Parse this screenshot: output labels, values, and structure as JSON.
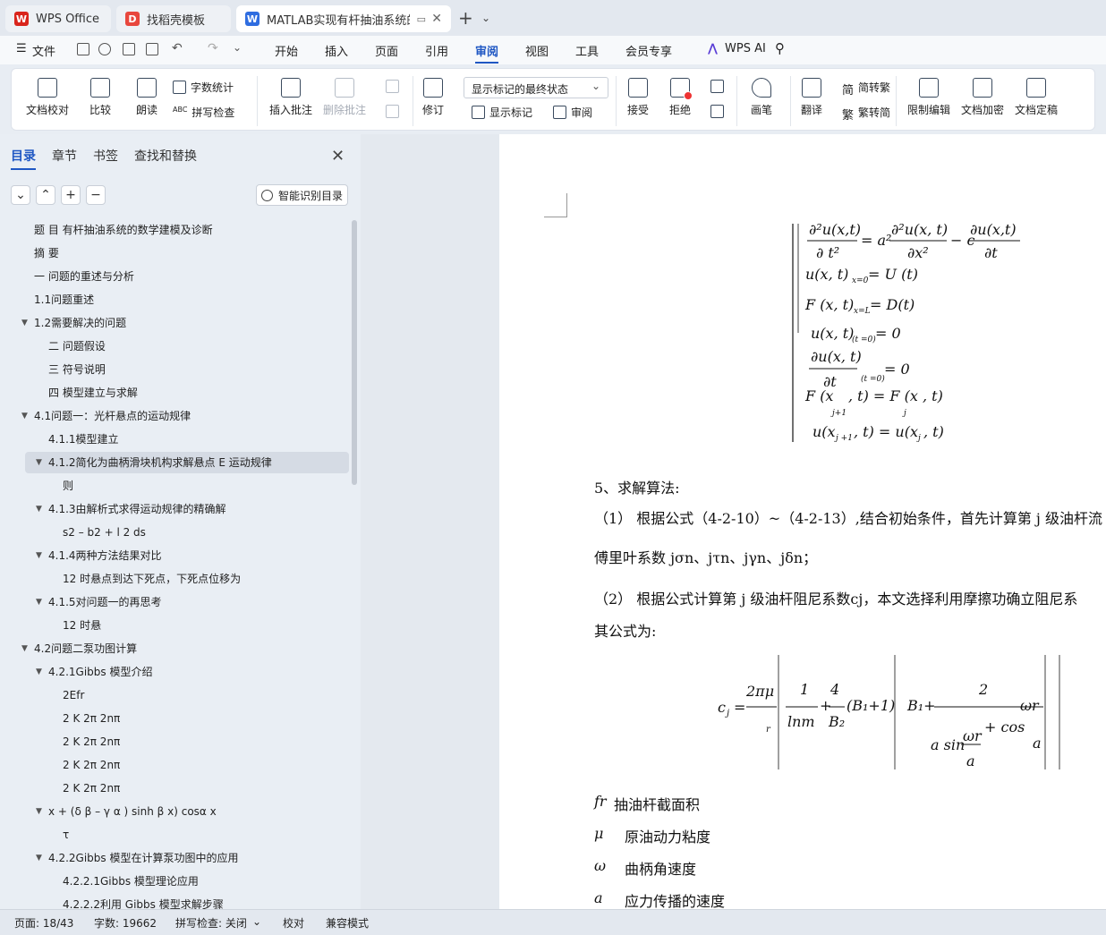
{
  "tabs": [
    {
      "label": "WPS Office",
      "logo": "W"
    },
    {
      "label": "找稻壳模板",
      "logo": "D"
    },
    {
      "label": "MATLAB实现有杆抽油系统的",
      "logo": "W"
    }
  ],
  "menu": {
    "file": "文件",
    "items": [
      "开始",
      "插入",
      "页面",
      "引用",
      "审阅",
      "视图",
      "工具",
      "会员专享"
    ],
    "active": "审阅",
    "wps_ai": "WPS AI"
  },
  "ribbon": {
    "doc_check": "文档校对",
    "compare": "比较",
    "read_aloud": "朗读",
    "word_count": "字数统计",
    "spell_check": "拼写检查",
    "insert_comment": "插入批注",
    "delete_comment": "删除批注",
    "revise": "修订",
    "markup_select": "显示标记的最终状态",
    "show_markup": "显示标记",
    "review": "审阅",
    "accept": "接受",
    "reject": "拒绝",
    "draw": "画笔",
    "translate": "翻译",
    "to_traditional": "简转繁",
    "to_simplified": "繁转简",
    "restrict_edit": "限制编辑",
    "encrypt": "文档加密",
    "finalize": "文档定稿"
  },
  "sidebar": {
    "tabs": [
      "目录",
      "章节",
      "书签",
      "查找和替换"
    ],
    "active_tab": "目录",
    "smart_btn": "智能识别目录",
    "toc": [
      {
        "text": "题 目  有杆抽油系统的数学建模及诊断",
        "level": 0,
        "arrow": false
      },
      {
        "text": "摘  要",
        "level": 0,
        "arrow": false
      },
      {
        "text": "一 问题的重述与分析",
        "level": 0,
        "arrow": false
      },
      {
        "text": "1.1问题重述",
        "level": 0,
        "arrow": false
      },
      {
        "text": "1.2需要解决的问题",
        "level": 0,
        "arrow": true
      },
      {
        "text": "二 问题假设",
        "level": 1,
        "arrow": false
      },
      {
        "text": "三 符号说明",
        "level": 1,
        "arrow": false
      },
      {
        "text": "四 模型建立与求解",
        "level": 1,
        "arrow": false
      },
      {
        "text": "4.1问题一：光杆悬点的运动规律",
        "level": 0,
        "arrow": true
      },
      {
        "text": "4.1.1模型建立",
        "level": 1,
        "arrow": false
      },
      {
        "text": "4.1.2简化为曲柄滑块机构求解悬点 E 运动规律",
        "level": 1,
        "arrow": true,
        "selected": true
      },
      {
        "text": "则",
        "level": 2,
        "arrow": false
      },
      {
        "text": "4.1.3由解析式求得运动规律的精确解",
        "level": 1,
        "arrow": true
      },
      {
        "text": "s2 – b2 + l 2 ds",
        "level": 2,
        "arrow": false
      },
      {
        "text": "4.1.4两种方法结果对比",
        "level": 1,
        "arrow": true
      },
      {
        "text": "12 时悬点到达下死点，下死点位移为",
        "level": 2,
        "arrow": false
      },
      {
        "text": "4.1.5对问题一的再思考",
        "level": 1,
        "arrow": true
      },
      {
        "text": "12 时悬",
        "level": 2,
        "arrow": false
      },
      {
        "text": "4.2问题二泵功图计算",
        "level": 0,
        "arrow": true
      },
      {
        "text": "4.2.1Gibbs 模型介绍",
        "level": 1,
        "arrow": true
      },
      {
        "text": "2Efr",
        "level": 2,
        "arrow": false
      },
      {
        "text": "2  K  2π  2nπ",
        "level": 2,
        "arrow": false
      },
      {
        "text": "2  K  2π  2nπ",
        "level": 2,
        "arrow": false
      },
      {
        "text": "2  K  2π  2nπ",
        "level": 2,
        "arrow": false
      },
      {
        "text": "2  K  2π  2nπ",
        "level": 2,
        "arrow": false
      },
      {
        "text": "x + (δ β – γ α ) sinh β x) cosα x",
        "level": 1,
        "arrow": true
      },
      {
        "text": "τ",
        "level": 2,
        "arrow": false
      },
      {
        "text": "4.2.2Gibbs 模型在计算泵功图中的应用",
        "level": 1,
        "arrow": true
      },
      {
        "text": "4.2.2.1Gibbs 模型理论应用",
        "level": 2,
        "arrow": false
      },
      {
        "text": "4.2.2.2利用 Gibbs 模型求解步骤",
        "level": 2,
        "arrow": false
      }
    ]
  },
  "doc": {
    "eq_system": [
      "∂²u(x,t)/∂t² = a²·∂²u(x,t)/∂x² − c·∂u(x,t)/∂t",
      "u(x,t)|x=0 = U(t)",
      "F(x,t)|x=L = D(t)",
      "u(x,t)|(t=0) = 0",
      "∂u(x,t)/∂t |(t=0) = 0",
      "F(xj+1, t) = F(xj, t)",
      "u(xj+1, t) = u(xj, t)"
    ],
    "heading": "5、求解算法:",
    "p1": "（1）  根据公式（4-2-10）~（4-2-13）,结合初始条件，首先计算第 j 级油杆流",
    "p2": "傅里叶系数 jσn、jτn、jγn、jδn；",
    "p3": "（2）  根据公式计算第 j 级油杆阻尼系数cj，本文选择利用摩擦功确立阻尼系",
    "p4": "其公式为:",
    "symbols": [
      {
        "sym": "fr",
        "desc": "抽油杆截面积"
      },
      {
        "sym": "μ",
        "desc": "原油动力粘度"
      },
      {
        "sym": "ω",
        "desc": "曲柄角速度"
      },
      {
        "sym": "a",
        "desc": "应力传播的速度"
      }
    ]
  },
  "status": {
    "page": "页面: 18/43",
    "words": "字数: 19662",
    "spell": "拼写检查: 关闭",
    "proof": "校对",
    "compat": "兼容模式"
  }
}
